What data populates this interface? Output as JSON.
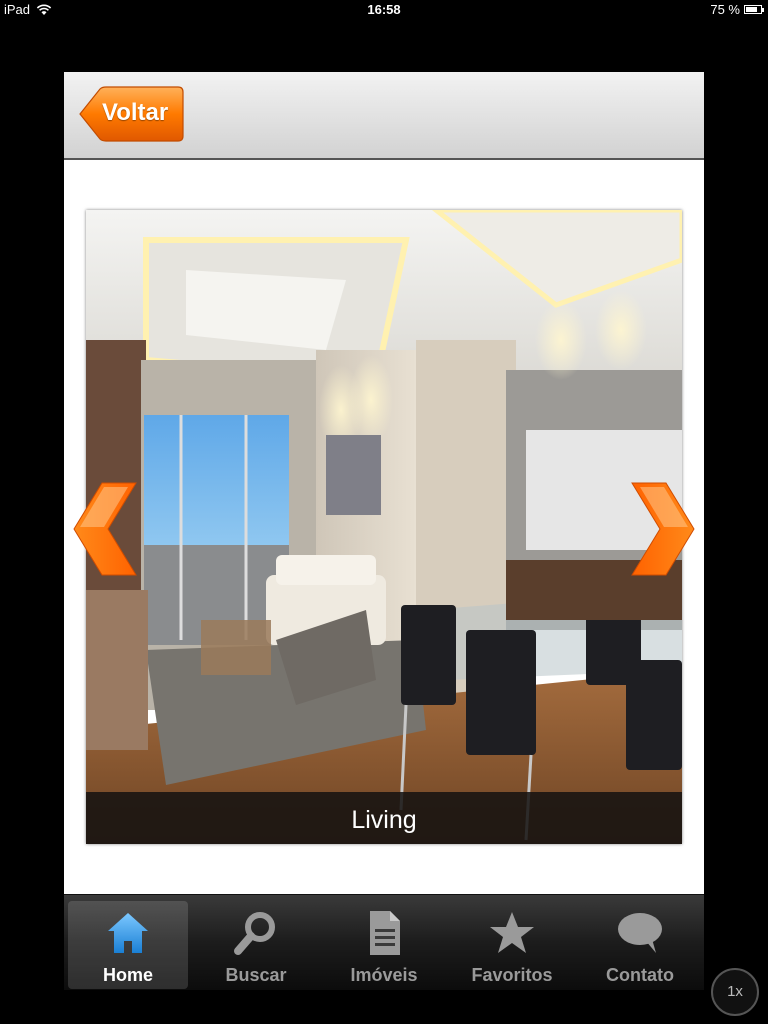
{
  "status_bar": {
    "device": "iPad",
    "time": "16:58",
    "battery": "75 %",
    "battery_level": 0.75
  },
  "nav": {
    "back_label": "Voltar",
    "back_icon": "orange-back-arrow-icon"
  },
  "gallery": {
    "caption": "Living",
    "image_alt": "Living room rendering",
    "prev_icon": "chevron-left-icon",
    "next_icon": "chevron-right-icon",
    "accent_color": "#ff7a00"
  },
  "tabs": [
    {
      "label": "Home",
      "icon": "home-icon",
      "active": true
    },
    {
      "label": "Buscar",
      "icon": "search-icon",
      "active": false
    },
    {
      "label": "Imóveis",
      "icon": "document-icon",
      "active": false
    },
    {
      "label": "Favoritos",
      "icon": "star-icon",
      "active": false
    },
    {
      "label": "Contato",
      "icon": "chat-bubble-icon",
      "active": false
    }
  ],
  "zoom_badge": "1x"
}
